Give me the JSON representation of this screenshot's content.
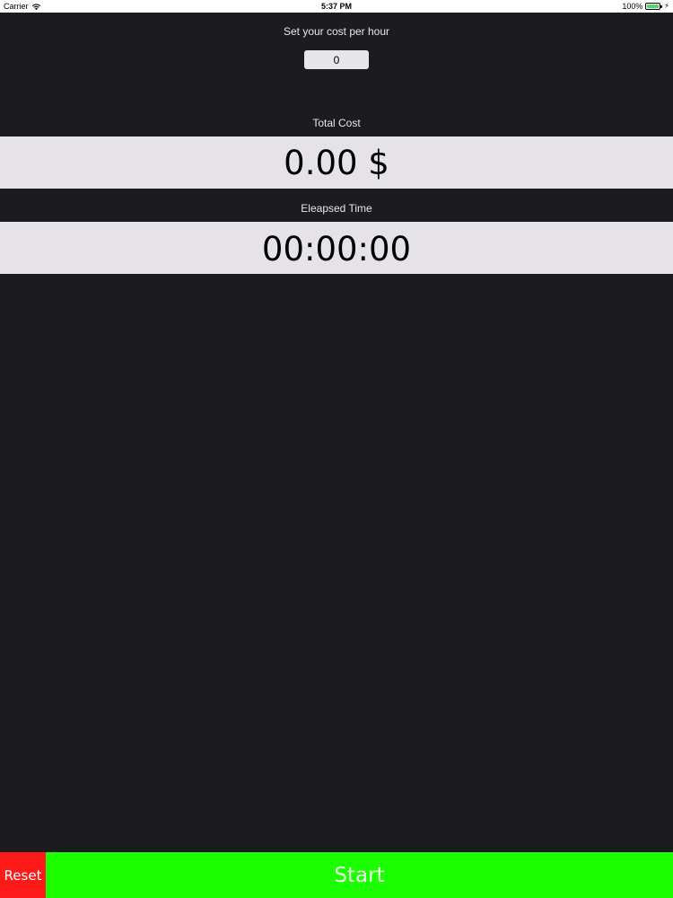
{
  "status_bar": {
    "carrier": "Carrier",
    "time": "5:37 PM",
    "battery": "100%",
    "icons": [
      "wifi-icon",
      "battery-icon",
      "charging-icon"
    ]
  },
  "cost_section": {
    "label": "Set your cost per hour",
    "input_value": "0"
  },
  "total_cost": {
    "label": "Total Cost",
    "value": "0.00 $"
  },
  "elapsed_time": {
    "label": "Eleapsed Time",
    "value": "00:00:00"
  },
  "buttons": {
    "reset_label": "Reset",
    "start_label": "Start"
  },
  "colors": {
    "background": "#1c1b1f",
    "display_band": "#e5e3e8",
    "reset": "#ff1a1a",
    "start": "#1bff00",
    "battery": "#4cd964"
  }
}
